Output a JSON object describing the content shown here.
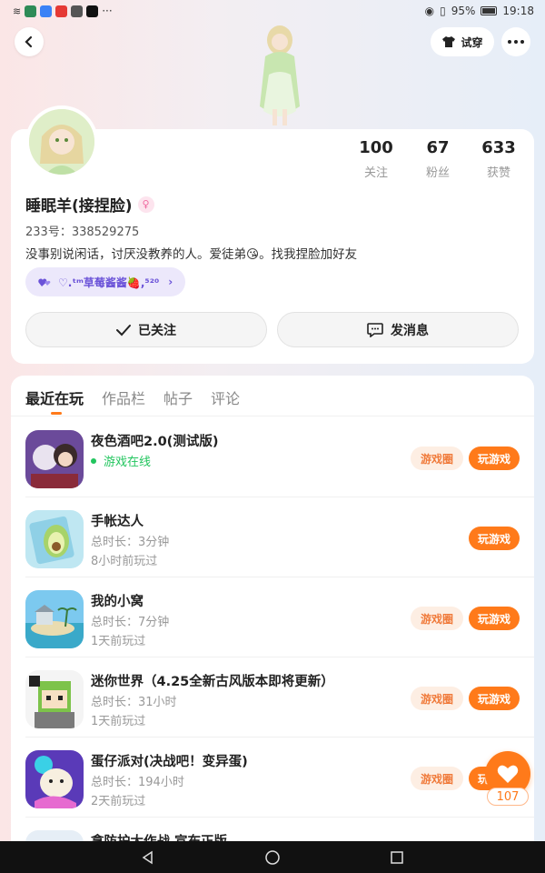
{
  "status_bar": {
    "time": "19:18",
    "battery": "95%",
    "left_icons": [
      "wifi-icon",
      "network-icon",
      "shield-app-icon",
      "red-app-icon",
      "chat-app-icon",
      "tiktok-icon",
      "more-dots-icon"
    ]
  },
  "header": {
    "tryon_label": "试穿"
  },
  "profile": {
    "stats": [
      {
        "value": "100",
        "label": "关注"
      },
      {
        "value": "67",
        "label": "粉丝"
      },
      {
        "value": "633",
        "label": "获赞"
      }
    ],
    "username": "睡眠羊(接捏脸)",
    "gender_symbol": "♀",
    "uid": "233号：338529275",
    "bio": "没事别说闲话，讨厌没教养的人。爱徒弟😘。找我捏脸加好友",
    "tag": "♡.ᵗᵐ草莓酱酱🍓,⁵²⁰",
    "follow_label": "已关注",
    "message_label": "发消息"
  },
  "tabs": [
    "最近在玩",
    "作品栏",
    "帖子",
    "评论"
  ],
  "games": [
    {
      "title": "夜色酒吧2.0(测试版)",
      "line1": "游戏在线",
      "line2": "",
      "online": true,
      "circle": true
    },
    {
      "title": "手帐达人",
      "line1": "总时长：3分钟",
      "line2": "8小时前玩过",
      "online": false,
      "circle": false
    },
    {
      "title": "我的小窝",
      "line1": "总时长：7分钟",
      "line2": "1天前玩过",
      "online": false,
      "circle": true
    },
    {
      "title": "迷你世界（4.25全新古风版本即将更新）",
      "line1": "总时长：31小时",
      "line2": "1天前玩过",
      "online": false,
      "circle": true
    },
    {
      "title": "蛋仔派对(决战吧！变异蛋)",
      "line1": "总时长：194小时",
      "line2": "2天前玩过",
      "online": false,
      "circle": true
    },
    {
      "title": "拿防护大作战 宣布正版",
      "line1": "",
      "line2": "",
      "online": false,
      "circle": false
    }
  ],
  "buttons": {
    "circle_label": "游戏圈",
    "play_label": "玩游戏"
  },
  "fav": {
    "count": "107"
  },
  "colors": {
    "accent": "#ff7a1a",
    "online": "#22c55e",
    "tag_bg": "#ece8fb"
  }
}
